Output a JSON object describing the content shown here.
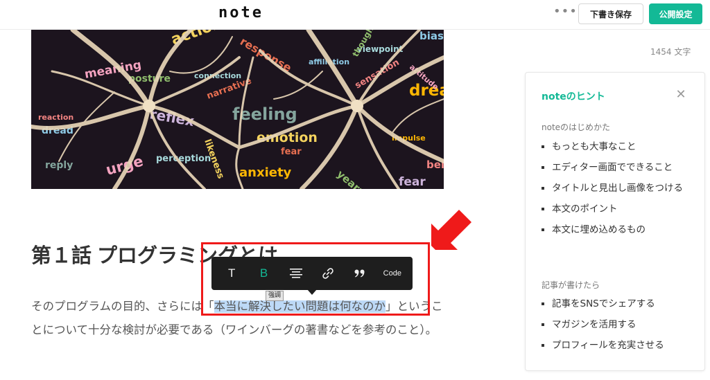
{
  "header": {
    "logo": "note",
    "more_label": "•••",
    "draft_label": "下書き保存",
    "publish_label": "公開設定"
  },
  "hero_image": {
    "words": [
      "action",
      "response",
      "bias",
      "meaning",
      "viewpoint",
      "dread",
      "posture",
      "sensation",
      "reflex",
      "feeling",
      "emotion",
      "fear",
      "dread",
      "urge",
      "perception",
      "anxiety",
      "yearning",
      "belief",
      "fear",
      "reply",
      "likeness",
      "narrative",
      "affiliation",
      "attitude",
      "connection",
      "impulse",
      "thought",
      "reaction"
    ]
  },
  "article": {
    "heading": "第１話 プログラミングとは",
    "body_before": "そのプログラムの目的、さらには「",
    "body_highlight": "本当に解決したい問題は何なのか",
    "body_after": "」ということについて十分な検討が必要である（ワインバーグの著書などを参考のこと）。"
  },
  "toolbar": {
    "text_label": "T",
    "bold_label": "B",
    "code_label": "Code",
    "tooltip": "強調"
  },
  "sidebar": {
    "char_count": "1454 文字",
    "hint_title": "noteのヒント",
    "sections": [
      {
        "title": "noteのはじめかた",
        "items": [
          "もっとも大事なこと",
          "エディター画面でできること",
          "タイトルと見出し画像をつける",
          "本文のポイント",
          "本文に埋め込めるもの"
        ]
      },
      {
        "title": "記事が書けたら",
        "items": [
          "記事をSNSでシェアする",
          "マガジンを活用する",
          "プロフィールを充実させる"
        ]
      }
    ]
  },
  "colors": {
    "accent": "#13b996",
    "annotation": "#ef1a1a",
    "highlight": "#bdd9f6"
  }
}
